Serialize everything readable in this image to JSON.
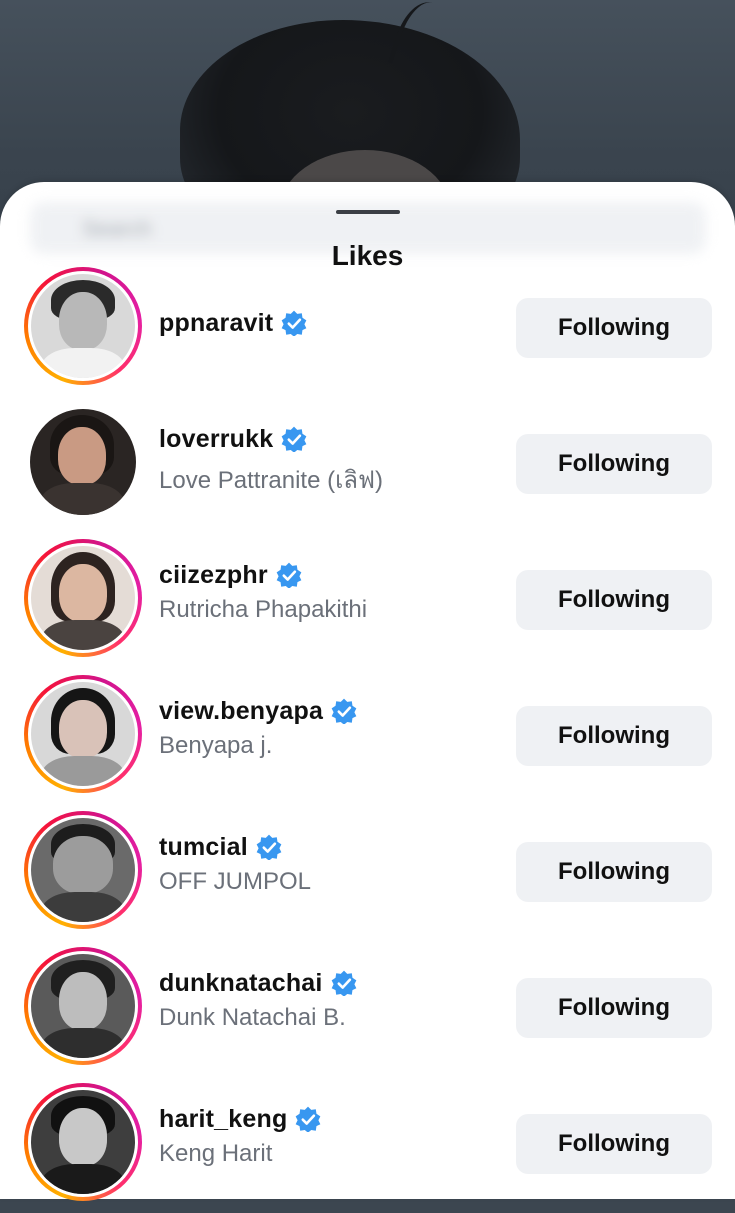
{
  "sheet": {
    "title": "Likes",
    "search_placeholder": "Search"
  },
  "colors": {
    "verified": "#3897f0",
    "button_bg": "#eff1f4",
    "story_ring": [
      "#ffb000",
      "#ff7a00",
      "#f5133b",
      "#d1148c"
    ]
  },
  "likes": [
    {
      "username": "ppnaravit",
      "full_name": "",
      "verified": true,
      "story_ring": true,
      "button": "Following"
    },
    {
      "username": "loverrukk",
      "full_name": "Love Pattranite (เลิฟ)",
      "verified": true,
      "story_ring": false,
      "button": "Following"
    },
    {
      "username": "ciizezphr",
      "full_name": "Rutricha Phapakithi",
      "verified": true,
      "story_ring": true,
      "button": "Following"
    },
    {
      "username": "view.benyapa",
      "full_name": "Benyapa j.",
      "verified": true,
      "story_ring": true,
      "button": "Following"
    },
    {
      "username": "tumcial",
      "full_name": "OFF JUMPOL",
      "verified": true,
      "story_ring": true,
      "button": "Following"
    },
    {
      "username": "dunknatachai",
      "full_name": "Dunk Natachai B.",
      "verified": true,
      "story_ring": true,
      "button": "Following"
    },
    {
      "username": "harit_keng",
      "full_name": "Keng Harit",
      "verified": true,
      "story_ring": true,
      "button": "Following"
    }
  ]
}
